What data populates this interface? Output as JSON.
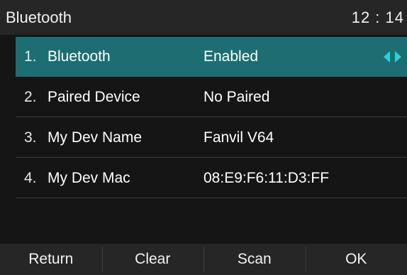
{
  "header": {
    "title": "Bluetooth",
    "time": "12 : 14"
  },
  "menu": {
    "items": [
      {
        "index": "1.",
        "label": "Bluetooth",
        "value": "Enabled",
        "selected": true
      },
      {
        "index": "2.",
        "label": "Paired Device",
        "value": "No Paired"
      },
      {
        "index": "3.",
        "label": "My Dev Name",
        "value": "Fanvil V64"
      },
      {
        "index": "4.",
        "label": "My Dev Mac",
        "value": "08:E9:F6:11:D3:FF"
      }
    ],
    "selected_icon": "left-right-arrows-icon"
  },
  "softkeys": [
    "Return",
    "Clear",
    "Scan",
    "OK"
  ],
  "colors": {
    "accent": "#1c6e72",
    "arrow": "#2fd0d8"
  }
}
